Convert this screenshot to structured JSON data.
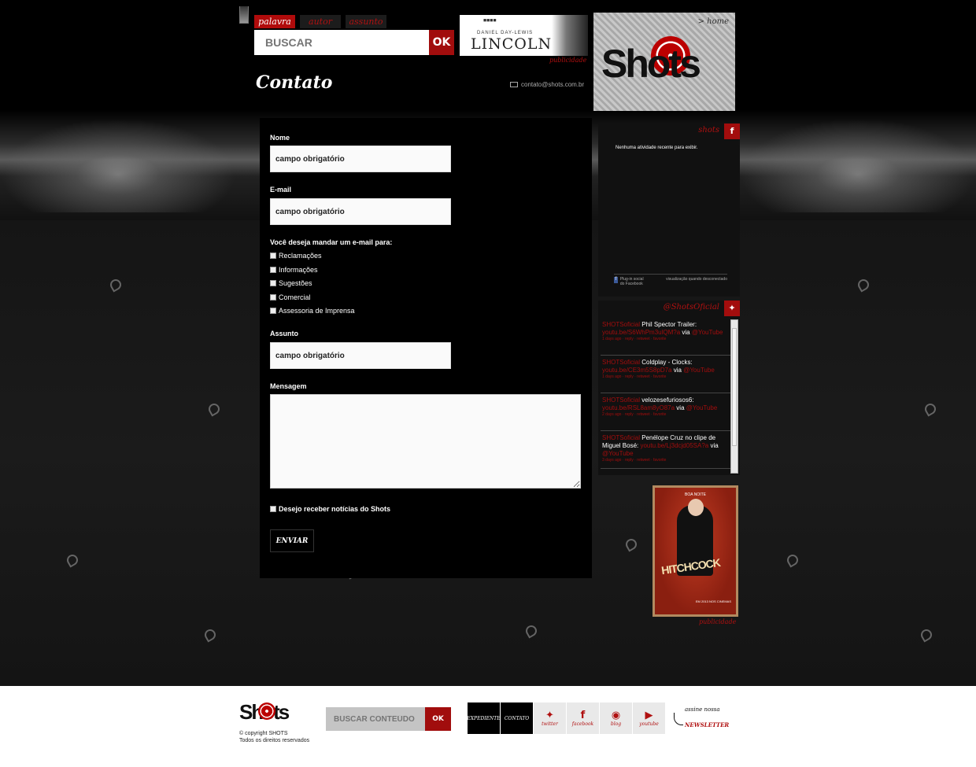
{
  "search": {
    "tabs": [
      {
        "label": "palavra"
      },
      {
        "label": "autor"
      },
      {
        "label": "assunto"
      }
    ],
    "placeholder": "BUSCAR",
    "ok_label": "OK"
  },
  "ad_top": {
    "credit": "DANIEL DAY-LEWIS",
    "title": "LINCOLN",
    "label": "publicidade"
  },
  "logo": {
    "text": "Shots",
    "home_link": "> home"
  },
  "page": {
    "title": "Contato",
    "email": "contato@shots.com.br"
  },
  "form": {
    "name_label": "Nome",
    "name_value": "campo obrigatório",
    "email_label": "E-mail",
    "email_value": "campo obrigatório",
    "send_to_label": "Você deseja mandar um e-mail para:",
    "options": [
      "Reclamações",
      "Informações",
      "Sugestões",
      "Comercial",
      "Assessoria de Imprensa"
    ],
    "subject_label": "Assunto",
    "subject_value": "campo obrigatório",
    "message_label": "Mensagem",
    "newsletter_label": "Desejo receber notícias do Shots",
    "submit_label": "ENVIAR"
  },
  "facebook": {
    "title": "shots",
    "icon": "f",
    "empty_text": "Nenhuma atividade recente para exibir.",
    "plugin_label": "Plug-in social do Facebook",
    "disconnected_label": "visualização quando desconectado"
  },
  "twitter": {
    "title": "@ShotsOficial",
    "tweets": [
      {
        "user": "SHOTSoficial",
        "text": "Phil Spector Trailer:",
        "link": "youtu.be/S6WhPm3ulQM?a",
        "via": "via",
        "mention": "@YouTube",
        "meta": "1 days ago · reply · retweet · favorite"
      },
      {
        "user": "SHOTSoficial",
        "text": "Coldplay - Clocks:",
        "link": "youtu.be/CE3m5S8pD7a",
        "via": "via",
        "mention": "@YouTube",
        "meta": "1 days ago · reply · retweet · favorite"
      },
      {
        "user": "SHOTSoficial",
        "text": "velozesefuriosos6:",
        "link": "youtu.be/RSL8am8yO87a",
        "via": "via",
        "mention": "@YouTube",
        "meta": "2 days ago · reply · retweet · favorite"
      },
      {
        "user": "SHOTSoficial",
        "text": "Penélope Cruz no clipe de Miguel Bosé:",
        "link": "youtu.be/Lj3dcjd05SA?a",
        "via": "via",
        "mention": "@YouTube",
        "meta": "3 days ago · reply · retweet · favorite"
      }
    ]
  },
  "ad_side": {
    "top_text": "BOA NOITE",
    "title": "HITCHCOCK",
    "date_text": "EM 2013 NOS CINEMAS",
    "label": "publicidade"
  },
  "footer": {
    "logo_text": "Shots",
    "copyright_1": "© copyright SHOTS",
    "copyright_2": "Todos os direitos reservados",
    "search_placeholder": "BUSCAR CONTEÚDO",
    "search_ok": "OK",
    "nav": [
      {
        "label": "EXPEDIENTE",
        "icon": ""
      },
      {
        "label": "CONTATO",
        "icon": ""
      },
      {
        "label": "twitter",
        "icon": "twitter-icon"
      },
      {
        "label": "facebook",
        "icon": "facebook-icon"
      },
      {
        "label": "blog",
        "icon": "blog-icon"
      },
      {
        "label": "youtube",
        "icon": "youtube-icon"
      }
    ],
    "newsletter_top": "assine nossa",
    "newsletter_main": "NEWSLETTER"
  }
}
